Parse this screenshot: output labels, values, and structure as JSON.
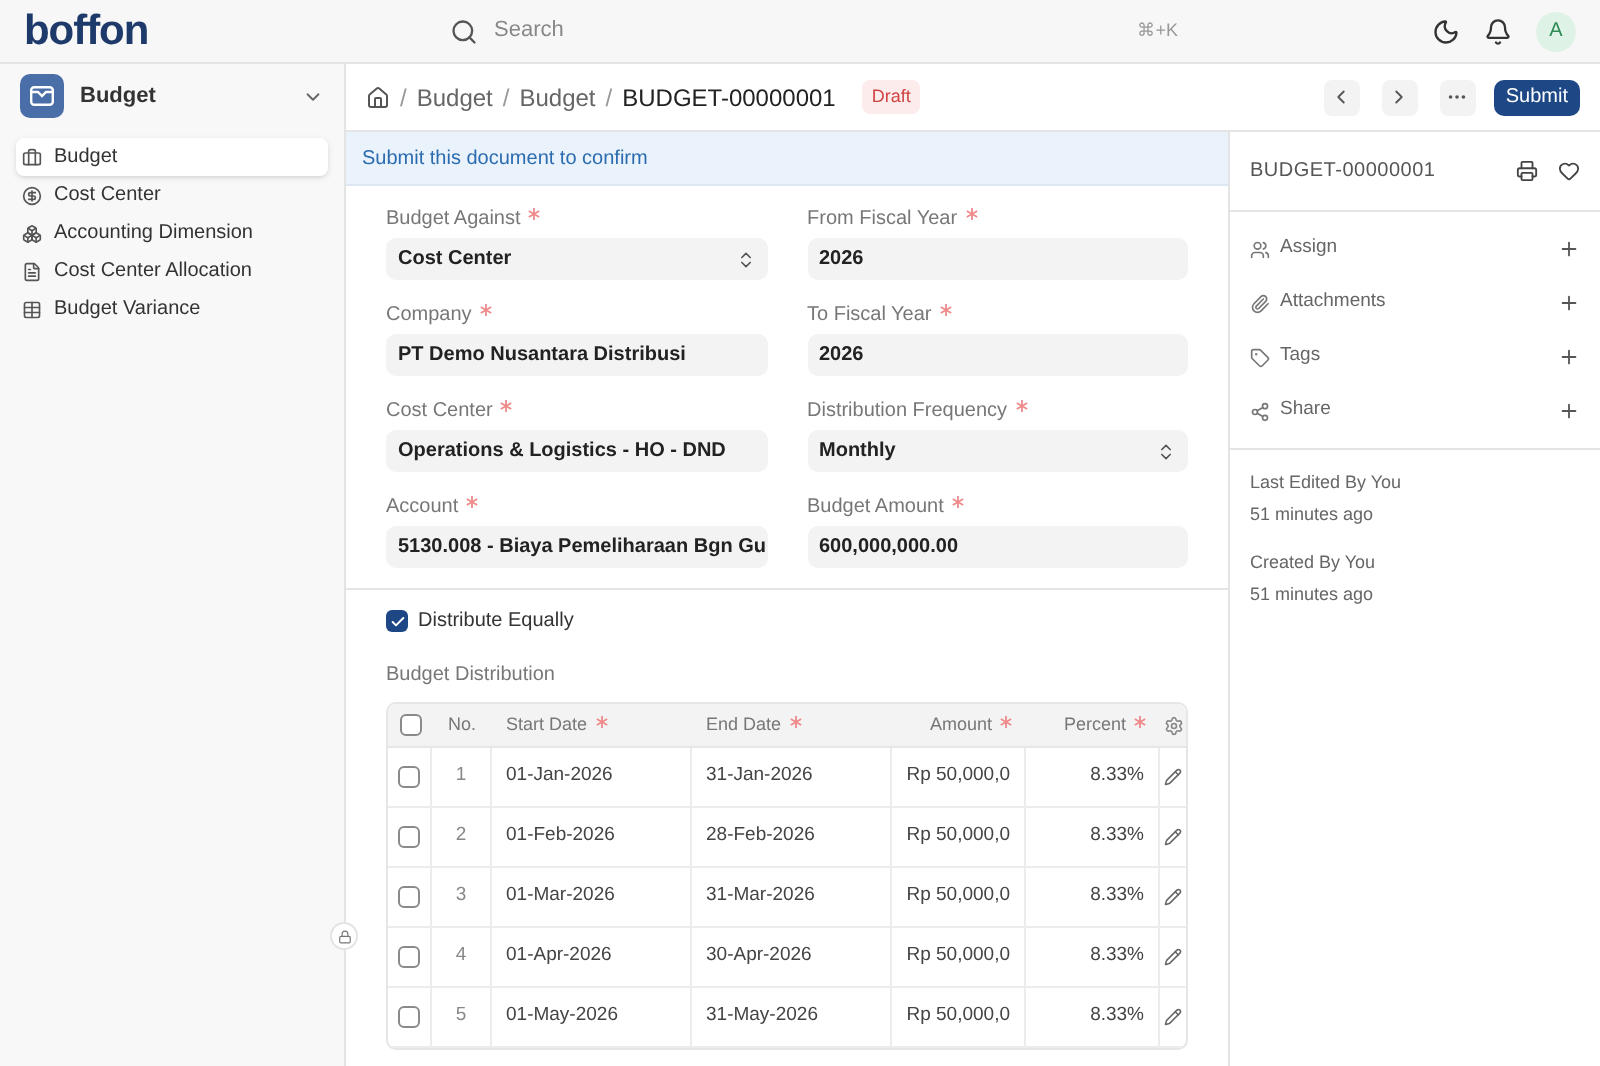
{
  "topbar": {
    "logo": "boffon",
    "search": {
      "placeholder": "Search",
      "shortcut": "⌘+K"
    },
    "avatar": "A"
  },
  "sidebar": {
    "module": "Budget",
    "items": [
      {
        "label": "Budget",
        "selected": true
      },
      {
        "label": "Cost Center",
        "selected": false
      },
      {
        "label": "Accounting Dimension",
        "selected": false
      },
      {
        "label": "Cost Center Allocation",
        "selected": false
      },
      {
        "label": "Budget Variance",
        "selected": false
      }
    ]
  },
  "header": {
    "separator": "/",
    "breadcrumbs": [
      "Budget",
      "Budget"
    ],
    "title": "BUDGET-00000001",
    "status": "Draft",
    "primary_button": "Submit"
  },
  "banner": "Submit this document to confirm",
  "fields": [
    {
      "label": "Budget Against",
      "required": true,
      "kind": "select",
      "value": "Cost Center"
    },
    {
      "label": "From Fiscal Year",
      "required": true,
      "kind": "text",
      "value": "2026"
    },
    {
      "label": "Company",
      "required": true,
      "kind": "text",
      "value": "PT Demo Nusantara Distribusi"
    },
    {
      "label": "To Fiscal Year",
      "required": true,
      "kind": "text",
      "value": "2026"
    },
    {
      "label": "Cost Center",
      "required": true,
      "kind": "text",
      "value": "Operations & Logistics - HO - DND"
    },
    {
      "label": "Distribution Frequency",
      "required": true,
      "kind": "select",
      "value": "Monthly"
    },
    {
      "label": "Account",
      "required": true,
      "kind": "text",
      "value": "5130.008 - Biaya Pemeliharaan Bgn Gu"
    },
    {
      "label": "Budget Amount",
      "required": true,
      "kind": "text",
      "value": "600,000,000.00"
    }
  ],
  "distribute_equally": {
    "label": "Distribute Equally",
    "checked": true
  },
  "table": {
    "title": "Budget Distribution",
    "all_checked": false,
    "columns": [
      {
        "label": "No.",
        "required": false
      },
      {
        "label": "Start Date",
        "required": true
      },
      {
        "label": "End Date",
        "required": true
      },
      {
        "label": "Amount",
        "required": true
      },
      {
        "label": "Percent",
        "required": true
      }
    ],
    "rows": [
      {
        "checked": false,
        "cells": [
          "1",
          "01-Jan-2026",
          "31-Jan-2026",
          "Rp 50,000,0",
          "8.33%"
        ]
      },
      {
        "checked": false,
        "cells": [
          "2",
          "01-Feb-2026",
          "28-Feb-2026",
          "Rp 50,000,0",
          "8.33%"
        ]
      },
      {
        "checked": false,
        "cells": [
          "3",
          "01-Mar-2026",
          "31-Mar-2026",
          "Rp 50,000,0",
          "8.33%"
        ]
      },
      {
        "checked": false,
        "cells": [
          "4",
          "01-Apr-2026",
          "30-Apr-2026",
          "Rp 50,000,0",
          "8.33%"
        ]
      },
      {
        "checked": false,
        "cells": [
          "5",
          "01-May-2026",
          "31-May-2026",
          "Rp 50,000,0",
          "8.33%"
        ]
      }
    ]
  },
  "side_panel": {
    "title": "BUDGET-00000001",
    "actions": [
      "Assign",
      "Attachments",
      "Tags",
      "Share"
    ],
    "meta": [
      "Last Edited By You",
      "51 minutes ago",
      "Created By You",
      "51 minutes ago"
    ]
  }
}
